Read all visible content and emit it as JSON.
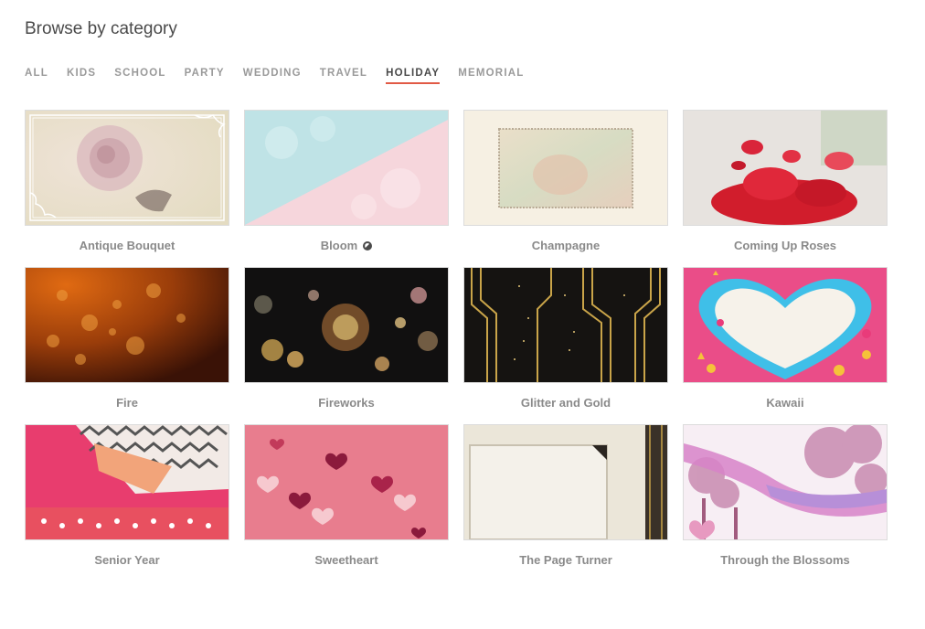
{
  "header": {
    "title": "Browse by category"
  },
  "tabs": [
    {
      "label": "ALL",
      "active": false
    },
    {
      "label": "KIDS",
      "active": false
    },
    {
      "label": "SCHOOL",
      "active": false
    },
    {
      "label": "PARTY",
      "active": false
    },
    {
      "label": "WEDDING",
      "active": false
    },
    {
      "label": "TRAVEL",
      "active": false
    },
    {
      "label": "HOLIDAY",
      "active": true
    },
    {
      "label": "MEMORIAL",
      "active": false
    }
  ],
  "accent_color": "#e15a45",
  "themes": [
    {
      "name": "Antique Bouquet"
    },
    {
      "name": "Bloom",
      "premium_icon": "premium-badge-icon"
    },
    {
      "name": "Champagne"
    },
    {
      "name": "Coming Up Roses"
    },
    {
      "name": "Fire"
    },
    {
      "name": "Fireworks"
    },
    {
      "name": "Glitter and Gold"
    },
    {
      "name": "Kawaii"
    },
    {
      "name": "Senior Year"
    },
    {
      "name": "Sweetheart"
    },
    {
      "name": "The Page Turner"
    },
    {
      "name": "Through the Blossoms"
    }
  ]
}
